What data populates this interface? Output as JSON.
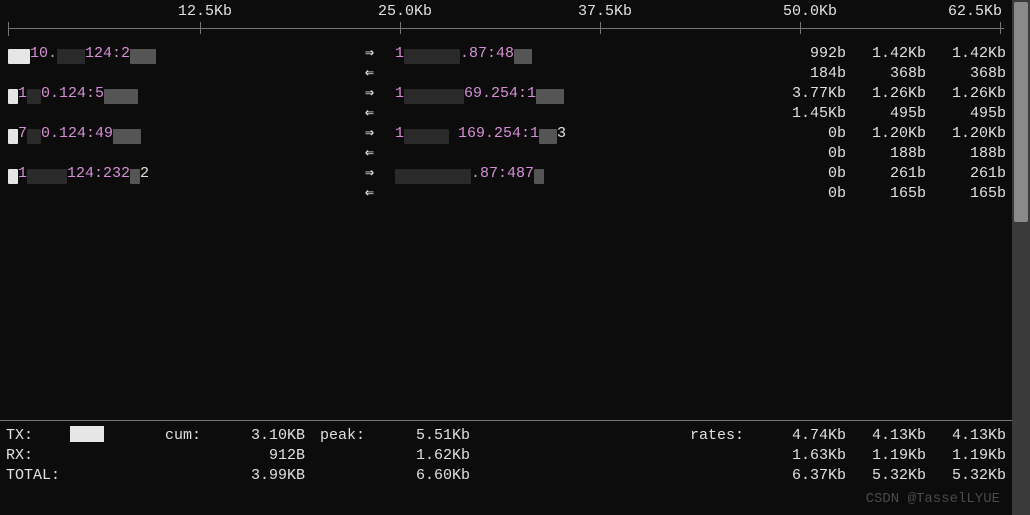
{
  "scale": {
    "ticks": [
      "12.5Kb",
      "25.0Kb",
      "37.5Kb",
      "50.0Kb",
      "62.5Kb"
    ]
  },
  "connections": [
    {
      "src_pre": "10.",
      "src_mid_hidden": "xxxx",
      "src_post": "124:2",
      "src_port_hidden": "xxx",
      "dst_pre": "1",
      "dst_mid_hidden": "xxxxxxx",
      "dst_post": ".87:48",
      "dst_port_hidden": "xx",
      "tx": [
        "992b",
        "1.42Kb",
        "1.42Kb"
      ],
      "rx": [
        "184b",
        "368b",
        "368b"
      ]
    },
    {
      "src_pre": "1",
      "src_mid_hidden": "x",
      "src_mid2": "0.124:5",
      "src_port_hidden": "xxxx",
      "dst_pre": "1",
      "dst_mid_hidden": "xxxxxxx",
      "dst_post": "69.254:1",
      "dst_port_hidden": "xxx",
      "tx": [
        "3.77Kb",
        "1.26Kb",
        "1.26Kb"
      ],
      "rx": [
        "1.45Kb",
        "495b",
        "495b"
      ]
    },
    {
      "src_pre": "7",
      "src_mid_hidden": "x",
      "src_mid2": "0.124:49",
      "src_port_hidden": "xxx",
      "dst_pre": "1",
      "dst_mid_hidden": "xxxxx",
      "dst_post": " 169.254:1",
      "dst_port_visible": "3",
      "dst_port_hidden": "xx",
      "tx": [
        "0b",
        "1.20Kb",
        "1.20Kb"
      ],
      "rx": [
        "0b",
        "188b",
        "188b"
      ]
    },
    {
      "src_pre": "1",
      "src_mid_hidden": "xxxxx",
      "src_mid2": "124:232",
      "src_port_visible": "2",
      "dst_pre": "",
      "dst_mid_hidden": "xxxxxxxxx",
      "dst_post": ".87:487",
      "dst_port_hidden": "x",
      "tx": [
        "0b",
        "261b",
        "261b"
      ],
      "rx": [
        "0b",
        "165b",
        "165b"
      ]
    }
  ],
  "arrows": {
    "tx": "⇒",
    "rx": "⇐"
  },
  "totals": {
    "labels": {
      "tx": "TX:",
      "rx": "RX:",
      "total": "TOTAL:",
      "cum": "cum:",
      "peak": "peak:",
      "rates": "rates:"
    },
    "tx": {
      "cum": "3.10KB",
      "peak": "5.51Kb",
      "rates": [
        "4.74Kb",
        "4.13Kb",
        "4.13Kb"
      ]
    },
    "rx": {
      "cum": "912B",
      "peak": "1.62Kb",
      "rates": [
        "1.63Kb",
        "1.19Kb",
        "1.19Kb"
      ]
    },
    "total": {
      "cum": "3.99KB",
      "peak": "6.60Kb",
      "rates": [
        "6.37Kb",
        "5.32Kb",
        "5.32Kb"
      ]
    }
  },
  "watermark": "CSDN @TasselLYUE"
}
